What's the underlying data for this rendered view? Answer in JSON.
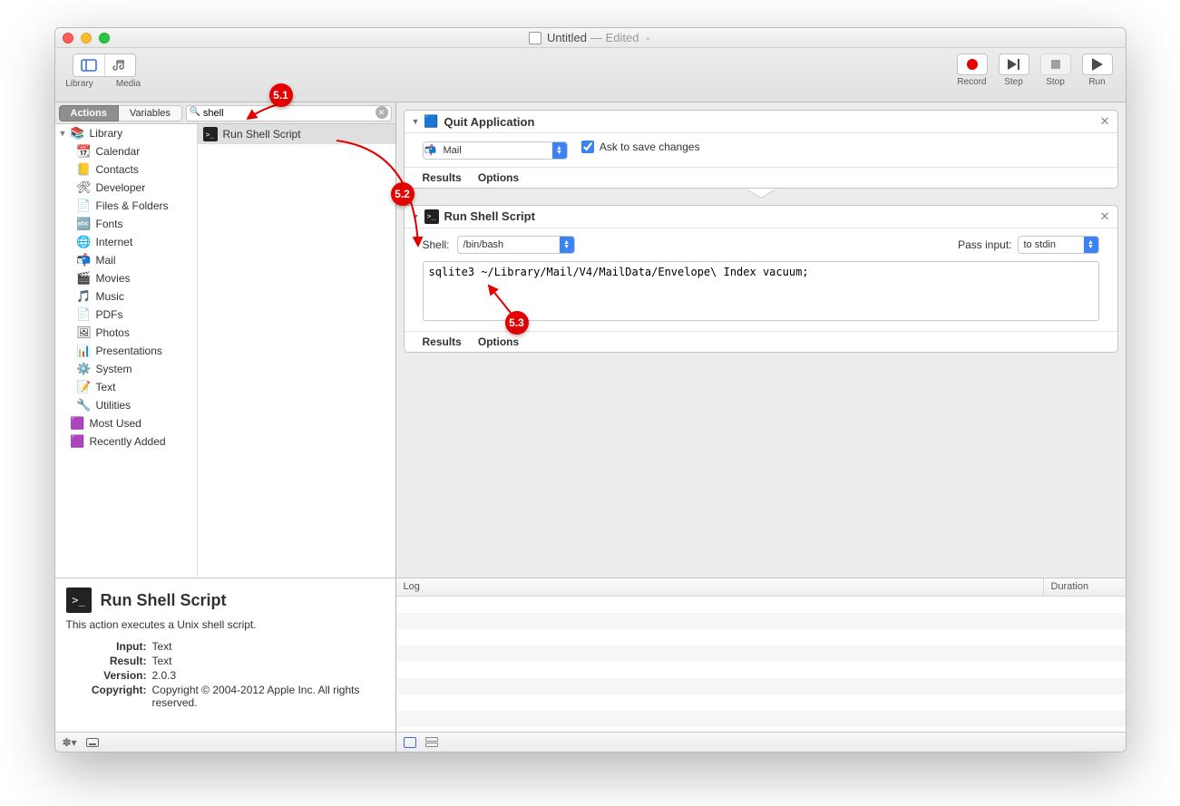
{
  "window": {
    "title": "Untitled",
    "edited": "— Edited",
    "caret": "⌄"
  },
  "toolbar": {
    "library": "Library",
    "media": "Media",
    "record": "Record",
    "step": "Step",
    "stop": "Stop",
    "run": "Run"
  },
  "tabs": {
    "actions": "Actions",
    "variables": "Variables"
  },
  "search": {
    "value": "shell",
    "placeholder": ""
  },
  "library": {
    "root": "Library",
    "items": [
      {
        "label": "Calendar",
        "icon": "📆"
      },
      {
        "label": "Contacts",
        "icon": "📒"
      },
      {
        "label": "Developer",
        "icon": "🛠"
      },
      {
        "label": "Files & Folders",
        "icon": "📄"
      },
      {
        "label": "Fonts",
        "icon": "🔤"
      },
      {
        "label": "Internet",
        "icon": "🌐"
      },
      {
        "label": "Mail",
        "icon": "📬"
      },
      {
        "label": "Movies",
        "icon": "🎬"
      },
      {
        "label": "Music",
        "icon": "🎵"
      },
      {
        "label": "PDFs",
        "icon": "📄"
      },
      {
        "label": "Photos",
        "icon": "🖼"
      },
      {
        "label": "Presentations",
        "icon": "📊"
      },
      {
        "label": "System",
        "icon": "⚙️"
      },
      {
        "label": "Text",
        "icon": "📝"
      },
      {
        "label": "Utilities",
        "icon": "🔧"
      }
    ],
    "most_used": "Most Used",
    "recently_added": "Recently Added"
  },
  "action_result": {
    "label": "Run Shell Script"
  },
  "info": {
    "title": "Run Shell Script",
    "desc": "This action executes a Unix shell script.",
    "kv": {
      "input_k": "Input:",
      "input_v": "Text",
      "result_k": "Result:",
      "result_v": "Text",
      "version_k": "Version:",
      "version_v": "2.0.3",
      "copyright_k": "Copyright:",
      "copyright_v": "Copyright © 2004-2012 Apple Inc.  All rights reserved."
    }
  },
  "workflow": {
    "quit": {
      "title": "Quit Application",
      "app": "Mail",
      "ask_label": "Ask to save changes",
      "ask_checked": true,
      "results": "Results",
      "options": "Options"
    },
    "shell": {
      "title": "Run Shell Script",
      "shell_label": "Shell:",
      "shell_value": "/bin/bash",
      "pass_label": "Pass input:",
      "pass_value": "to stdin",
      "script": "sqlite3 ~/Library/Mail/V4/MailData/Envelope\\ Index vacuum;",
      "results": "Results",
      "options": "Options"
    }
  },
  "log": {
    "col1": "Log",
    "col2": "Duration"
  },
  "annotations": {
    "a1": "5.1",
    "a2": "5.2",
    "a3": "5.3"
  }
}
